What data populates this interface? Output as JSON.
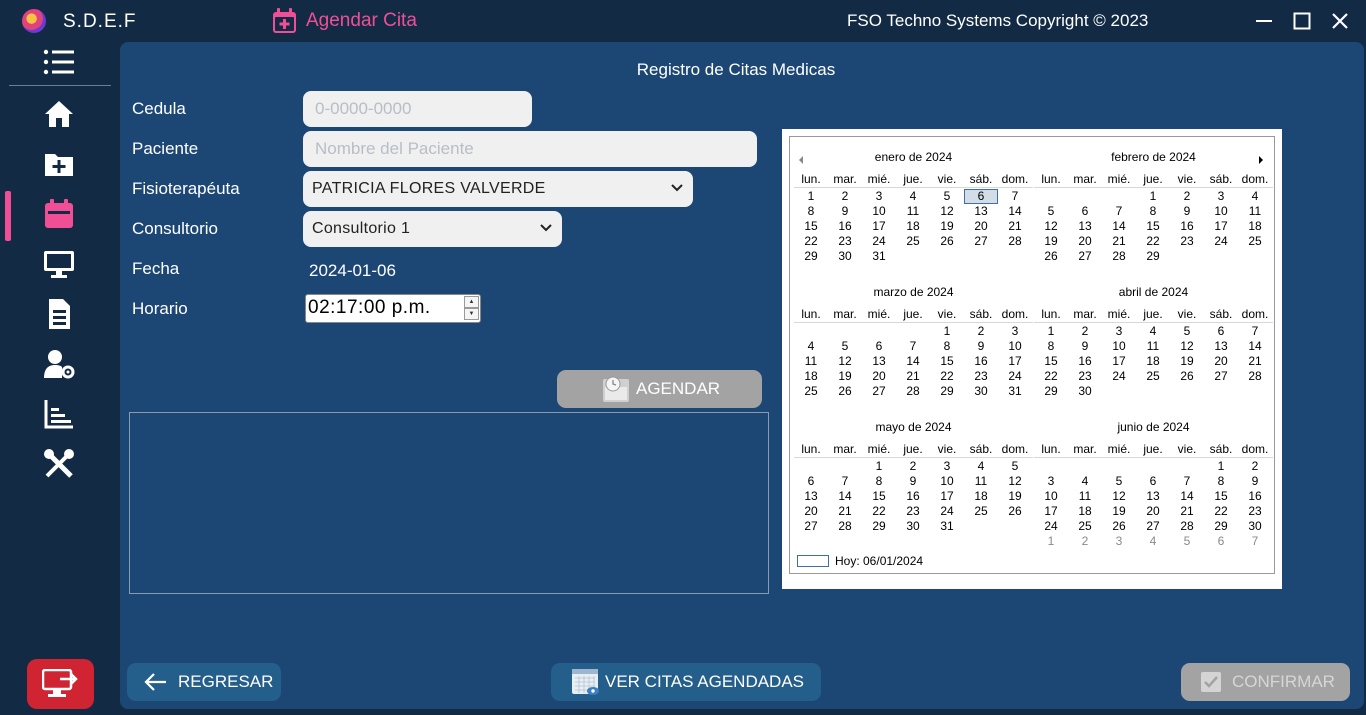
{
  "app": {
    "name": "S.D.E.F",
    "page_title": "Agendar Cita",
    "copyright": "FSO Techno Systems Copyright ©  2023"
  },
  "sidebar": {
    "items": [
      {
        "icon": "home-icon"
      },
      {
        "icon": "add-folder-icon"
      },
      {
        "icon": "calendar-icon",
        "active": true
      },
      {
        "icon": "monitor-icon"
      },
      {
        "icon": "document-icon"
      },
      {
        "icon": "user-settings-icon"
      },
      {
        "icon": "chart-icon"
      },
      {
        "icon": "tools-icon"
      }
    ],
    "accent": "#f04f96",
    "logout_color": "#d02432"
  },
  "form": {
    "title": "Registro de Citas Medicas",
    "cedula": {
      "label": "Cedula",
      "value": "",
      "placeholder": "0-0000-0000"
    },
    "paciente": {
      "label": "Paciente",
      "value": "",
      "placeholder": "Nombre del Paciente"
    },
    "fisioterapeuta": {
      "label": "Fisioterapéuta",
      "selected": "PATRICIA FLORES VALVERDE"
    },
    "consultorio": {
      "label": "Consultorio",
      "selected": "Consultorio 1"
    },
    "fecha": {
      "label": "Fecha",
      "value": "2024-01-06"
    },
    "horario": {
      "label": "Horario",
      "value": "02:17:00 p.m."
    },
    "agendar_label": "AGENDAR"
  },
  "calendar": {
    "dow": [
      "lun.",
      "mar.",
      "mié.",
      "jue.",
      "vie.",
      "sáb.",
      "dom."
    ],
    "selected": "2024-01-06",
    "months": [
      {
        "title": "enero de 2024",
        "year": 2024,
        "month": 1,
        "trailing": false
      },
      {
        "title": "febrero de 2024",
        "year": 2024,
        "month": 2,
        "trailing": false
      },
      {
        "title": "marzo de 2024",
        "year": 2024,
        "month": 3,
        "trailing": false
      },
      {
        "title": "abril de 2024",
        "year": 2024,
        "month": 4,
        "trailing": false
      },
      {
        "title": "mayo de 2024",
        "year": 2024,
        "month": 5,
        "trailing": false
      },
      {
        "title": "junio de 2024",
        "year": 2024,
        "month": 6,
        "trailing": true
      }
    ],
    "today_label": "Hoy: 06/01/2024"
  },
  "buttons": {
    "regresar": "REGRESAR",
    "ver_citas": "VER CITAS AGENDADAS",
    "confirmar": "CONFIRMAR"
  }
}
